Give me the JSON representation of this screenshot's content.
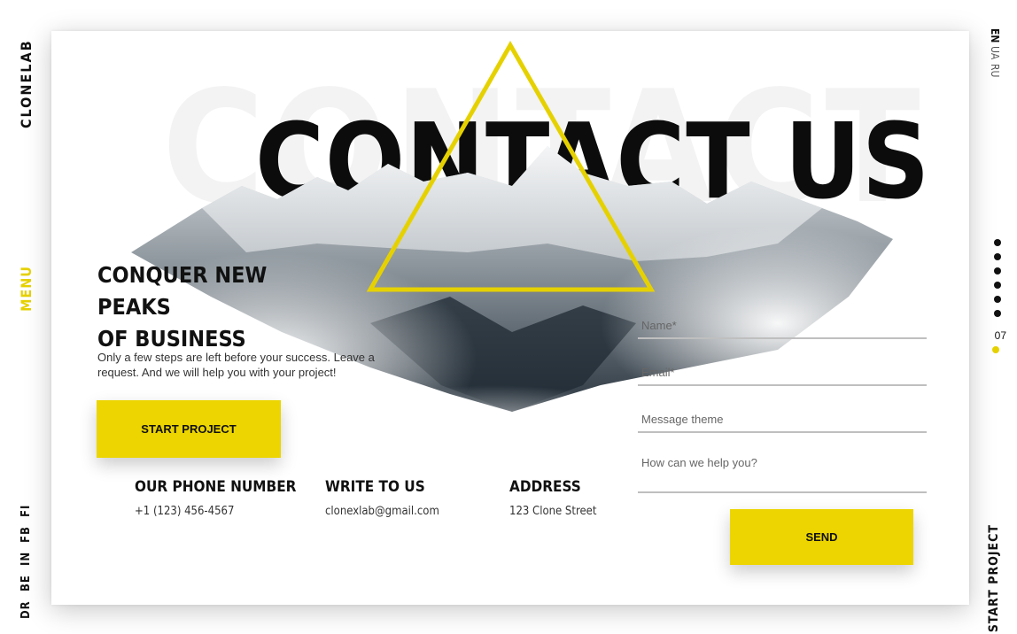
{
  "brand": {
    "logo": "CLONELAB"
  },
  "nav": {
    "menu_label": "MENU"
  },
  "socials": [
    "DR",
    "BE",
    "IN",
    "FB",
    "FI"
  ],
  "languages": [
    {
      "code": "EN",
      "active": true
    },
    {
      "code": "UA",
      "active": false
    },
    {
      "code": "RU",
      "active": false
    }
  ],
  "pager": {
    "dot_count": 6,
    "current_page": "07"
  },
  "side_cta": "START PROJECT",
  "hero": {
    "background_title": "CONTACT US",
    "title": "CONTACT US"
  },
  "intro": {
    "headline_line1": "CONQUER NEW PEAKS",
    "headline_line2": "OF BUSINESS",
    "description": "Only a few steps are left before your success. Leave a request. And we will help you with your project!",
    "cta_label": "START PROJECT"
  },
  "contacts": {
    "phone": {
      "label": "OUR PHONE NUMBER",
      "value": "+1 (123) 456-4567"
    },
    "email": {
      "label": "WRITE TO US",
      "value": "clonexlab@gmail.com"
    },
    "address": {
      "label": "ADDRESS",
      "value": "123 Clone Street"
    }
  },
  "form": {
    "name_placeholder": "Name*",
    "email_placeholder": "Email*",
    "theme_placeholder": "Message theme",
    "message_placeholder": "How can we help you?",
    "send_label": "SEND"
  },
  "colors": {
    "accent": "#ecd500",
    "text": "#111111"
  }
}
